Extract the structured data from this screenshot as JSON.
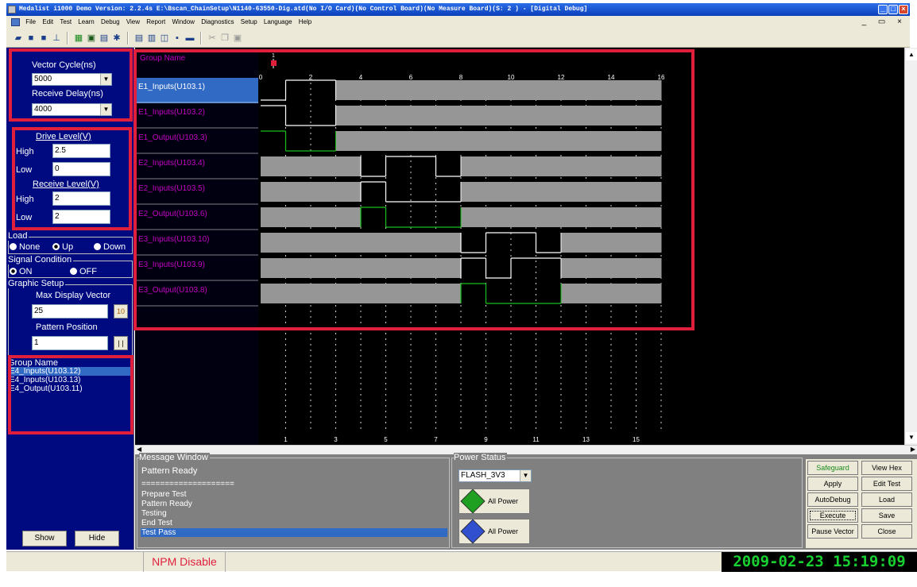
{
  "window": {
    "title": "Medalist i1000 Demo Version: 2.2.4s E:\\Bscan_ChainSetup\\N1140-63550-Dig.atd(No I/O Card)(No Control Board)(No Measure Board)(S: 2 ) - [Digital Debug]"
  },
  "menu": [
    "File",
    "Edit",
    "Test",
    "Learn",
    "Debug",
    "View",
    "Report",
    "Window",
    "Diagnostics",
    "Setup",
    "Language",
    "Help"
  ],
  "left": {
    "vector_cycle_label": "Vector Cycle(ns)",
    "vector_cycle_value": "5000",
    "receive_delay_label": "Receive Delay(ns)",
    "receive_delay_value": "4000",
    "drive_level_label": "Drive Level(V)",
    "receive_level_label": "Receive Level(V)",
    "high_label": "High",
    "low_label": "Low",
    "drive_high": "2.5",
    "drive_low": "0",
    "receive_high": "2",
    "receive_low": "2",
    "load_label": "Load",
    "load_options": [
      "None",
      "Up",
      "Down"
    ],
    "load_selected": "Up",
    "signal_label": "Signal Condition",
    "signal_options": [
      "ON",
      "OFF"
    ],
    "signal_selected": "ON",
    "graphic_label": "Graphic Setup",
    "max_vector_label": "Max Display Vector",
    "max_vector_value": "25",
    "max_vector_btn": "10",
    "pattern_pos_label": "Pattern Position",
    "pattern_pos_value": "1",
    "pattern_pos_btn": "| |",
    "group_name_label": "Group Name",
    "groups": [
      "E4_Inputs(U103.12)",
      "E4_Inputs(U103.13)",
      "E4_Output(U103.11)"
    ],
    "groups_selected": 0,
    "show_btn": "Show",
    "hide_btn": "Hide"
  },
  "waveform": {
    "header": "Group Name",
    "marker_label": "1",
    "top_ticks": [
      "0",
      "2",
      "4",
      "6",
      "8",
      "10",
      "12",
      "14",
      "16"
    ],
    "bottom_ticks": [
      "1",
      "3",
      "5",
      "7",
      "9",
      "11",
      "13",
      "15"
    ],
    "signals": [
      {
        "name": "E1_Inputs(U103.1)",
        "selected": true,
        "levels": "0 1 1 H H H H H H H H H H H H H",
        "color": "#ffffff"
      },
      {
        "name": "E1_Inputs(U103.2)",
        "selected": false,
        "levels": "1 0 0 H H H H H H H H H H H H H",
        "color": "#ffffff"
      },
      {
        "name": "E1_Output(U103.3)",
        "selected": false,
        "levels": "1 0 0 H H H H H H H H H H H H H",
        "color": "#19c019"
      },
      {
        "name": "E2_Inputs(U103.4)",
        "selected": false,
        "levels": "H H H H 0 1 1 0 H H H H H H H H",
        "color": "#ffffff"
      },
      {
        "name": "E2_Inputs(U103.5)",
        "selected": false,
        "levels": "H H H H 1 0 0 0 H H H H H H H H",
        "color": "#ffffff"
      },
      {
        "name": "E2_Output(U103.6)",
        "selected": false,
        "levels": "H H H H 1 0 0 0 H H H H H H H H",
        "color": "#19c019"
      },
      {
        "name": "E3_Inputs(U103.10)",
        "selected": false,
        "levels": "H H H H H H H H 0 1 1 0 H H H H",
        "color": "#ffffff"
      },
      {
        "name": "E3_Inputs(U103.9)",
        "selected": false,
        "levels": "H H H H H H H H 1 0 1 1 H H H H",
        "color": "#ffffff"
      },
      {
        "name": "E3_Output(U103.8)",
        "selected": false,
        "levels": "H H H H H H H H 1 0 0 0 H H H H",
        "color": "#19c019"
      }
    ]
  },
  "message": {
    "label": "Message Window",
    "lines": [
      "Pattern Ready",
      "====================",
      "Prepare Test",
      "Pattern Ready",
      "Testing",
      "End Test",
      "Test Pass"
    ],
    "selected": 6
  },
  "power": {
    "label": "Power Status",
    "rail": "FLASH_3V3",
    "on_label": "All Power On",
    "off_label": "All Power Off"
  },
  "actions": {
    "safeguard": "Safeguard",
    "view_hex": "View Hex",
    "apply_parameter": "Apply Parameter",
    "edit_test": "Edit Test",
    "autodebug": "AutoDebug",
    "load": "Load",
    "execute": "Execute",
    "save": "Save",
    "pause_vector": "Pause Vector",
    "close": "Close"
  },
  "status": {
    "npm": "NPM Disable",
    "datetime": "2009-02-23 15:19:09"
  },
  "colors": {
    "panel_bg": "#000a80",
    "highlight_red": "#e01f3c",
    "signal_magenta": "#c400c4",
    "wave_green": "#19c019",
    "clock_green": "#18d030"
  }
}
